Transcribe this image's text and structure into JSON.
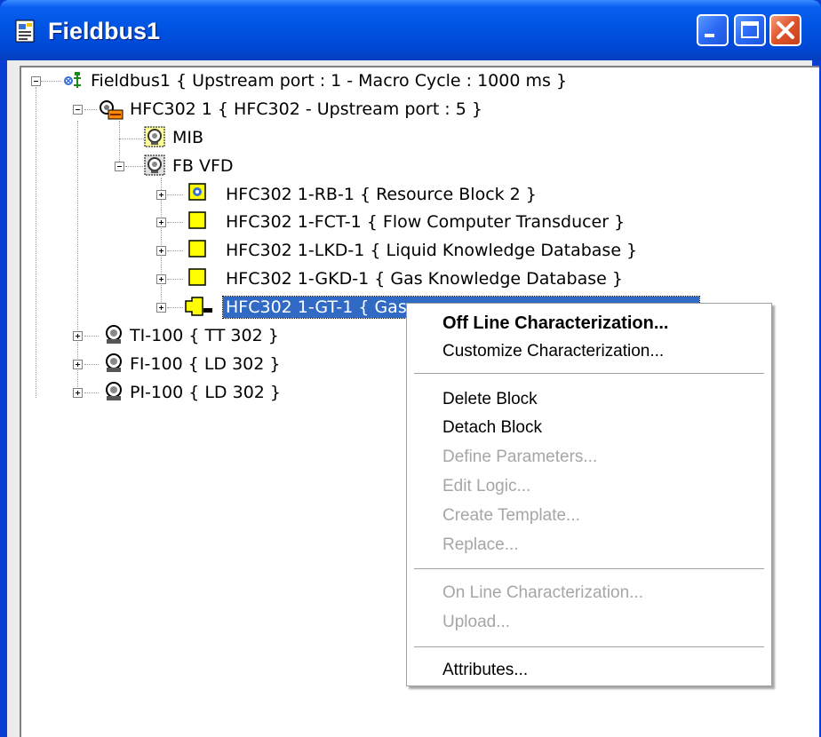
{
  "window": {
    "title": "Fieldbus1",
    "colors": {
      "title_bar": "#0054e3",
      "selection": "#316ac5",
      "block_icon": "#ffff00",
      "close_button": "#e0532a"
    }
  },
  "tree": {
    "root": "Fieldbus1 { Upstream port : 1 -  Macro Cycle : 1000 ms }",
    "device": "HFC302 1 { HFC302 -  Upstream port : 5 }",
    "mib": "MIB",
    "fbvfd": "FB VFD",
    "blocks": [
      "HFC302 1-RB-1 { Resource Block 2 }",
      "HFC302 1-FCT-1 { Flow Computer Transducer }",
      "HFC302 1-LKD-1 { Liquid Knowledge Database }",
      "HFC302 1-GKD-1 { Gas Knowledge Database }",
      "HFC302 1-GT-1 { Gas"
    ],
    "other_devices": [
      "TI-100 { TT 302 }",
      "FI-100 { LD 302 }",
      "PI-100 { LD 302 }"
    ]
  },
  "context_menu": {
    "items": [
      "Off Line Characterization...",
      "Customize Characterization...",
      "Delete Block",
      "Detach Block",
      "Define Parameters...",
      "Edit Logic...",
      "Create Template...",
      "Replace...",
      "On Line Characterization...",
      "Upload...",
      "Attributes..."
    ]
  }
}
